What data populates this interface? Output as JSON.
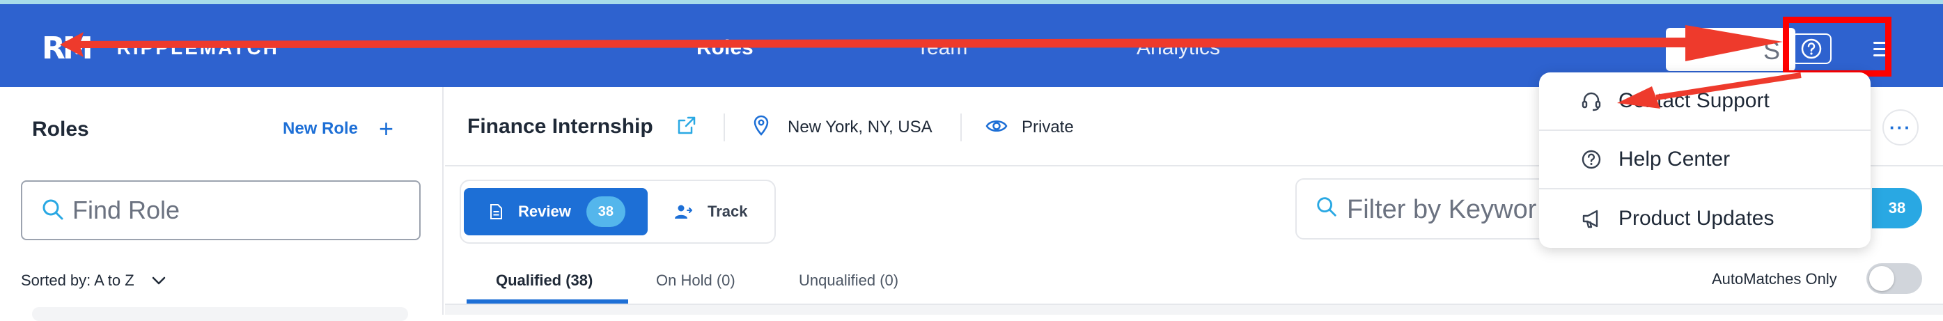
{
  "app": {
    "logo_mark": "RM",
    "logo_text": "RIPPLEMATCH",
    "brand_color": "#2e62cf",
    "accent_color": "#1d6fd6"
  },
  "nav": {
    "items": [
      {
        "label": "Roles"
      },
      {
        "label": "Team"
      },
      {
        "label": "Analytics"
      }
    ],
    "search_fragment": "S",
    "help_icon": "question-circle-icon",
    "menu_icon": "hamburger-menu-icon"
  },
  "help_menu": {
    "items": [
      {
        "label": "Contact Support",
        "icon": "headset-icon"
      },
      {
        "label": "Help Center",
        "icon": "question-circle-icon"
      },
      {
        "label": "Product Updates",
        "icon": "megaphone-icon"
      }
    ]
  },
  "sidebar": {
    "title": "Roles",
    "new_role_label": "New Role",
    "search_placeholder": "Find Role",
    "sorted_by": "Sorted by: A to Z"
  },
  "role": {
    "title": "Finance Internship",
    "location": "New York, NY, USA",
    "visibility": "Private",
    "more_label": "···"
  },
  "toolbar": {
    "review_label": "Review",
    "review_count": "38",
    "track_label": "Track",
    "keyword_placeholder": "Filter by Keywor",
    "result_count": "38"
  },
  "tabs": [
    {
      "label": "Qualified (38)",
      "active": true
    },
    {
      "label": "On Hold (0)",
      "active": false
    },
    {
      "label": "Unqualified (0)",
      "active": false
    }
  ],
  "automatches": {
    "label": "AutoMatches Only",
    "enabled": false
  },
  "annotation": {
    "color": "#ff0000"
  }
}
